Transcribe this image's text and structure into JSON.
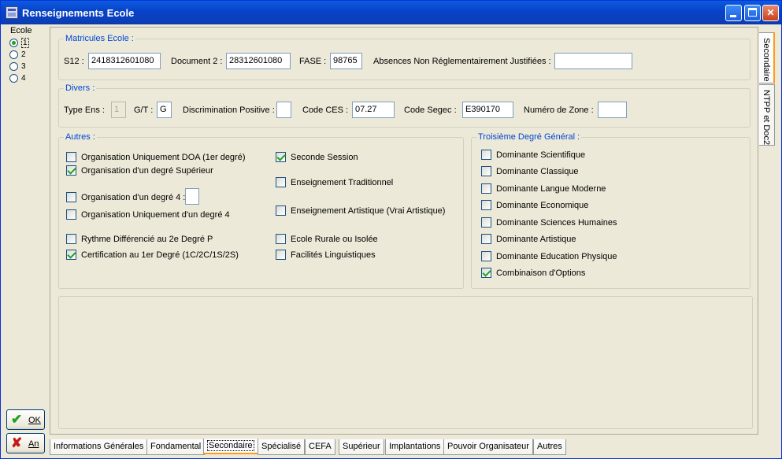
{
  "window": {
    "title": "Renseignements Ecole"
  },
  "ecole": {
    "label": "Ecole",
    "options": [
      "1",
      "2",
      "3",
      "4"
    ],
    "selected": "1"
  },
  "buttons": {
    "ok": "OK",
    "cancel": "An"
  },
  "matricules": {
    "legend": "Matricules Ecole :",
    "s12_label": "S12 :",
    "s12_value": "2418312601080",
    "doc2_label": "Document 2 :",
    "doc2_value": "28312601080",
    "fase_label": "FASE :",
    "fase_value": "98765",
    "absences_label": "Absences Non Réglementairement Justifiées :",
    "absences_value": ""
  },
  "divers": {
    "legend": "Divers :",
    "type_ens_label": "Type Ens :",
    "type_ens_value": "1",
    "gt_label": "G/T :",
    "gt_value": "G",
    "discrimination_label": "Discrimination Positive :",
    "discrimination_value": "",
    "code_ces_label": "Code CES :",
    "code_ces_value": "07.27",
    "code_segec_label": "Code Segec :",
    "code_segec_value": "E390170",
    "zone_label": "Numéro de Zone :",
    "zone_value": ""
  },
  "autres": {
    "legend": "Autres :",
    "doa_label": "Organisation Uniquement DOA (1er degré)",
    "doa_checked": false,
    "sup_label": "Organisation d'un degré Supérieur",
    "sup_checked": true,
    "deg4_label": "Organisation d'un degré 4 :",
    "deg4_checked": false,
    "deg4_value": "",
    "uniq4_label": "Organisation Uniquement d'un degré 4",
    "uniq4_checked": false,
    "rythme_label": "Rythme Différencié au 2e Degré P",
    "rythme_checked": false,
    "certif_label": "Certification au 1er Degré (1C/2C/1S/2S)",
    "certif_checked": true,
    "seconde_label": "Seconde Session",
    "seconde_checked": true,
    "trad_label": "Enseignement Traditionnel",
    "trad_checked": false,
    "artist_label": "Enseignement Artistique (Vrai Artistique)",
    "artist_checked": false,
    "rurale_label": "Ecole Rurale ou Isolée",
    "rurale_checked": false,
    "ling_label": "Facilités Linguistiques",
    "ling_checked": false
  },
  "troisieme": {
    "legend": "Troisième Degré Général :",
    "items": [
      {
        "label": "Dominante Scientifique",
        "checked": false
      },
      {
        "label": "Dominante Classique",
        "checked": false
      },
      {
        "label": "Dominante Langue Moderne",
        "checked": false
      },
      {
        "label": "Dominante Economique",
        "checked": false
      },
      {
        "label": "Dominante Sciences Humaines",
        "checked": false
      },
      {
        "label": "Dominante Artistique",
        "checked": false
      },
      {
        "label": "Dominante Education Physique",
        "checked": false
      },
      {
        "label": "Combinaison d'Options",
        "checked": true
      }
    ]
  },
  "side_tabs": [
    "Secondaire",
    "NTPP et Doc2"
  ],
  "side_tab_active": "Secondaire",
  "bottom_tabs": [
    "Informations Générales",
    "Fondamental",
    "Secondaire",
    "Spécialisé",
    "CEFA",
    "Supérieur",
    "Implantations",
    "Pouvoir Organisateur",
    "Autres"
  ],
  "bottom_tab_active": "Secondaire",
  "colors": {
    "titlebar": "#0842c8",
    "legend": "#0046d5",
    "check": "#21a121",
    "active_tab": "#ff9a1d"
  }
}
